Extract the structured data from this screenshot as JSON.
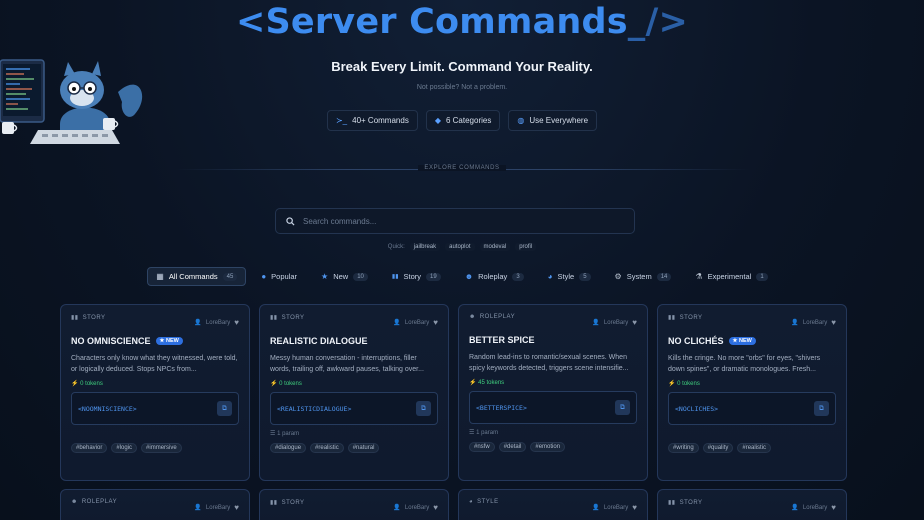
{
  "header": {
    "title": "<Server Commands",
    "title_cursor": "_/>",
    "subtitle": "Break Every Limit. Command Your Reality.",
    "tagline": "Not possible? Not a problem.",
    "stats": [
      {
        "icon": "terminal-icon",
        "glyph": "≻_",
        "label": "40+ Commands"
      },
      {
        "icon": "layers-icon",
        "glyph": "◆",
        "label": "6 Categories"
      },
      {
        "icon": "globe-icon",
        "glyph": "◍",
        "label": "Use Everywhere"
      }
    ]
  },
  "explore_label": "EXPLORE COMMANDS",
  "search": {
    "placeholder": "Search commands..."
  },
  "quick": {
    "label": "Quick:",
    "items": [
      "jailbreak",
      "autoplot",
      "modeval",
      "profil"
    ]
  },
  "tabs": [
    {
      "label": "All Commands",
      "count": "45",
      "glyph": "▦",
      "active": true
    },
    {
      "label": "Popular",
      "count": "",
      "glyph": "●",
      "active": false
    },
    {
      "label": "New",
      "count": "10",
      "glyph": "★",
      "active": false
    },
    {
      "label": "Story",
      "count": "19",
      "glyph": "▮▮",
      "active": false
    },
    {
      "label": "Roleplay",
      "count": "3",
      "glyph": "☻",
      "active": false
    },
    {
      "label": "Style",
      "count": "5",
      "glyph": "◕",
      "active": false
    },
    {
      "label": "System",
      "count": "14",
      "glyph": "⚙",
      "active": false
    },
    {
      "label": "Experimental",
      "count": "1",
      "glyph": "⚗",
      "active": false
    }
  ],
  "colors": {
    "accent": "#3d8cf0",
    "tokens": "#3fcf7e",
    "badge": "#2d6fe0"
  },
  "cards": [
    {
      "category": "STORY",
      "author": "LoreBary",
      "name": "NO OMNISCIENCE",
      "new_badge": "NEW",
      "desc": "Characters only know what they witnessed, were told, or logically deduced. Stops NPCs from...",
      "tokens": "0 tokens",
      "command": "<NOOMNISCIENCE>",
      "param": "",
      "tags": [
        "#behavior",
        "#logic",
        "#immersive"
      ]
    },
    {
      "category": "STORY",
      "author": "LoreBary",
      "name": "REALISTIC DIALOGUE",
      "new_badge": "",
      "desc": "Messy human conversation - interruptions, filler words, trailing off, awkward pauses, talking over...",
      "tokens": "0 tokens",
      "command": "<REALISTICDIALOGUE>",
      "param": "1 param",
      "tags": [
        "#dialogue",
        "#realistic",
        "#natural"
      ]
    },
    {
      "category": "ROLEPLAY",
      "author": "LoreBary",
      "name": "BETTER SPICE",
      "new_badge": "",
      "desc": "Random lead-ins to romantic/sexual scenes. When spicy keywords detected, triggers scene intensifie...",
      "tokens": "45 tokens",
      "command": "<BETTERSPICE>",
      "param": "1 param",
      "tags": [
        "#nsfw",
        "#detail",
        "#emotion"
      ]
    },
    {
      "category": "STORY",
      "author": "LoreBary",
      "name": "NO CLICHÉS",
      "new_badge": "NEW",
      "desc": "Kills the cringe. No more \"orbs\" for eyes, \"shivers down spines\", or dramatic monologues. Fresh...",
      "tokens": "0 tokens",
      "command": "<NOCLICHES>",
      "param": "",
      "tags": [
        "#writing",
        "#quality",
        "#realistic"
      ]
    }
  ],
  "stub_cards": [
    {
      "category": "ROLEPLAY",
      "author": "LoreBary"
    },
    {
      "category": "STORY",
      "author": "LoreBary"
    },
    {
      "category": "STYLE",
      "author": "LoreBary"
    },
    {
      "category": "STORY",
      "author": "LoreBary"
    }
  ]
}
